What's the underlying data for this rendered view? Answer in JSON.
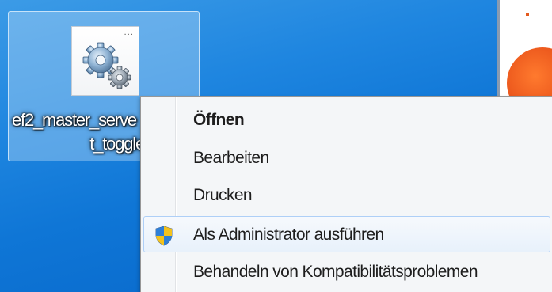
{
  "desktop": {
    "icon": {
      "label_line1": "ef2_master_serve",
      "label_line2": "t_toggle",
      "icon_name": "gear-icon",
      "thumb_dots": "..."
    }
  },
  "context_menu": {
    "items": [
      {
        "label": "Öffnen",
        "bold": true,
        "icon": ""
      },
      {
        "label": "Bearbeiten",
        "bold": false,
        "icon": ""
      },
      {
        "label": "Drucken",
        "bold": false,
        "icon": ""
      },
      {
        "label": "Als Administrator ausführen",
        "bold": false,
        "icon": "shield-icon",
        "highlighted": true
      },
      {
        "label": "Behandeln von Kompatibilitätsproblemen",
        "bold": false,
        "icon": ""
      }
    ]
  },
  "colors": {
    "desktop_blue": "#1f86e0",
    "menu_background": "#f4f6f8",
    "highlight_border": "#aecff7",
    "accent_orange": "#e9531a"
  }
}
